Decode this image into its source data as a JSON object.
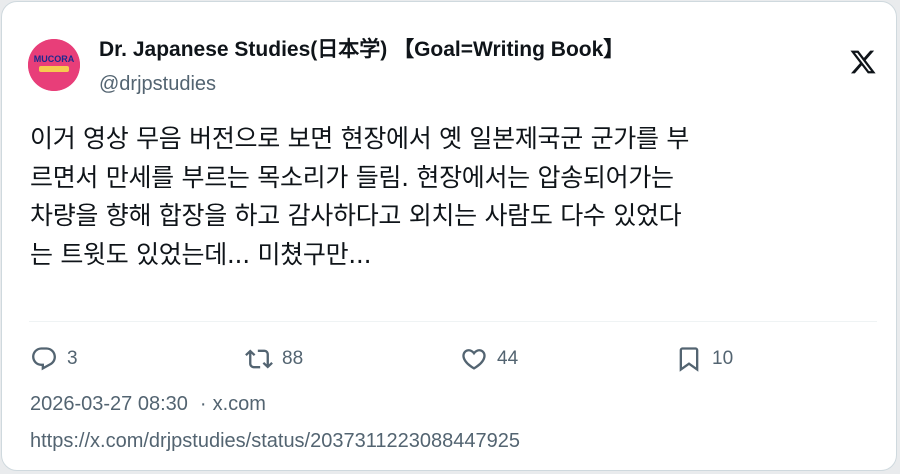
{
  "author": {
    "display_name": "Dr. Japanese Studies(日本学) 【Goal=Writing Book】",
    "handle": "@drjpstudies",
    "avatar_text": "MUCORA",
    "avatar_color": "#e83e79"
  },
  "tweet": {
    "lines": [
      "이거 영상 무음 버전으로 보면 현장에서 옛 일본제국군 군가를 부",
      "르면서 만세를 부르는 목소리가 들림. 현장에서는 압송되어가는",
      "차량을 향해 합장을 하고 감사하다고 외치는 사람도 다수 있었다",
      "는 트윗도 있었는데... 미쳤구만..."
    ]
  },
  "actions": {
    "replies": "3",
    "reposts": "88",
    "likes": "44",
    "bookmarks": "10"
  },
  "icons": {
    "brand": "x-logo-icon",
    "reply": "speech-bubble-icon",
    "repost": "repost-arrows-icon",
    "like": "heart-icon",
    "bookmark": "bookmark-icon"
  },
  "meta": {
    "timestamp": "2026-03-27 08:30",
    "separator": "·",
    "source": "x.com"
  },
  "url": "https://x.com/drjpstudies/status/2037311223088447925",
  "colors": {
    "text_primary": "#0f1419",
    "text_secondary": "#536471",
    "border": "#cfd9de"
  }
}
